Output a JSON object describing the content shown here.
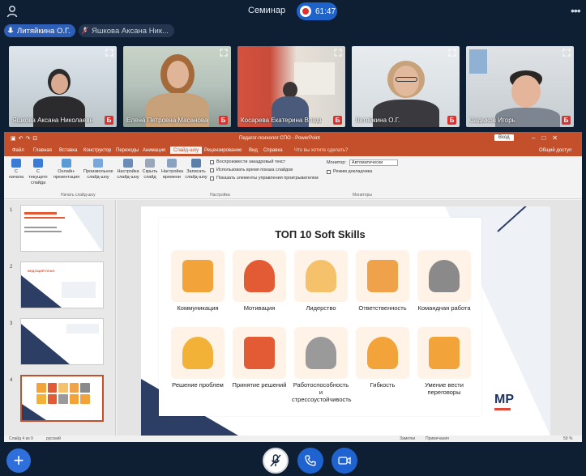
{
  "header": {
    "meeting_title": "Семинар",
    "timer": "61:47"
  },
  "participants_chips": [
    {
      "label": "Литяйкина О.Г.",
      "active": true
    },
    {
      "label": "Яшкова Аксана Ник...",
      "active": false
    }
  ],
  "video_tiles": [
    {
      "name": "Яшкова Аксана Николаевна",
      "muted_badge": "Б"
    },
    {
      "name": "Елена Петровна Масанова",
      "muted_badge": "Б"
    },
    {
      "name": "Косарева Екатерина Влади...",
      "muted_badge": "Б"
    },
    {
      "name": "Литяйкина О.Г.",
      "muted_badge": "Б"
    },
    {
      "name": "Садыков Игорь",
      "muted_badge": "Б"
    }
  ],
  "shared_screen": {
    "window_title": "Педагог-психолог СПО  -  PowerPoint",
    "search_hint": "Что вы хотите сделать?",
    "sign_in": "Вход",
    "share": "Общий доступ",
    "tabs": [
      "Файл",
      "Главная",
      "Вставка",
      "Конструктор",
      "Переходы",
      "Анимация",
      "Слайд-шоу",
      "Рецензирование",
      "Вид",
      "Справка"
    ],
    "active_tab": "Слайд-шоу",
    "ribbon_buttons": [
      "С начала",
      "С текущего слайда",
      "Онлайн-презентация",
      "Произвольное слайд-шоу",
      "Настройка слайд-шоу",
      "Скрыть слайд",
      "Настройка времени",
      "Записать слайд-шоу"
    ],
    "ribbon_checks": [
      "Воспроизвести закадровый текст",
      "Использовать время показа слайдов",
      "Показать элементы управления проигрывателем"
    ],
    "ribbon_groups": [
      "Начать слайд-шоу",
      "Настройка",
      "Мониторы"
    ],
    "monitor_label": "Монитор:",
    "monitor_value": "Автоматически",
    "presenter_mode": "Режим докладчика",
    "slide_numbers": [
      "1",
      "2",
      "3",
      "4"
    ],
    "thumb_texts": {
      "t2": "ВЕДУЩИЙ ПЛАН"
    },
    "slide": {
      "title": "ТОП 10 Soft Skills",
      "skills": [
        {
          "label": "Коммуникация",
          "color": "#f2a33a"
        },
        {
          "label": "Мотивация",
          "color": "#e25b34"
        },
        {
          "label": "Лидерство",
          "color": "#f5c26b"
        },
        {
          "label": "Ответственность",
          "color": "#f0a24a"
        },
        {
          "label": "Командная работа",
          "color": "#8a8a8a"
        },
        {
          "label": "Решение проблем",
          "color": "#f2b238"
        },
        {
          "label": "Принятие решений",
          "color": "#e25b34"
        },
        {
          "label": "Работоспособность и стрессоустойчивость",
          "color": "#9a9a9a"
        },
        {
          "label": "Гибкость",
          "color": "#f2a33a"
        },
        {
          "label": "Умение вести переговоры",
          "color": "#f2a33a"
        }
      ],
      "logo": "МР"
    },
    "status": {
      "slide_info": "Слайд 4 из 9",
      "language": "русский",
      "notes": "Заметки",
      "comments": "Примечания",
      "zoom": "59 %"
    }
  },
  "controls": {
    "add": "+"
  },
  "colors": {
    "background": "#0f1f33",
    "accent": "#1f63d1",
    "ppt_orange": "#c3502a",
    "record": "#e0312f"
  }
}
